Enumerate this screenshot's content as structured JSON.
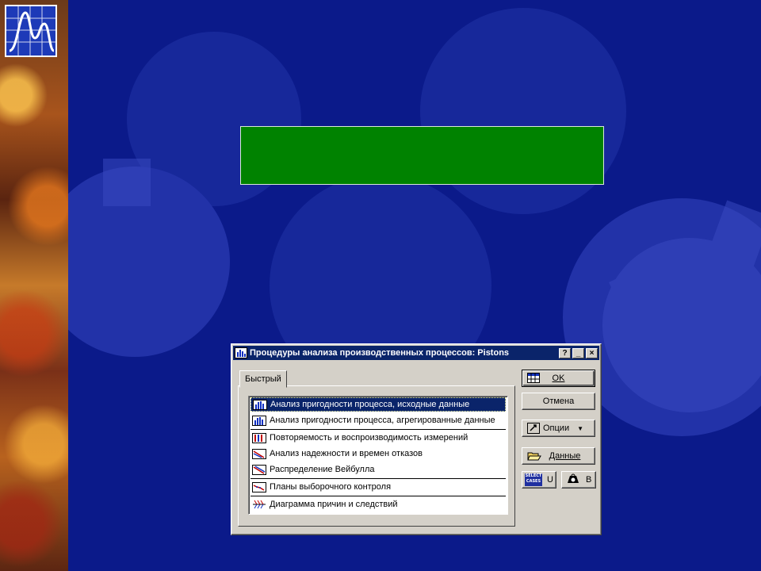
{
  "dialog": {
    "title": "Процедуры анализа производственных процессов: Pistons",
    "titlebar_buttons": {
      "help": "?",
      "minimize": "_",
      "close": "×"
    },
    "tab_label": "Быстрый",
    "list_items": [
      {
        "label": "Анализ пригодности процесса, исходные данные",
        "icon": "histogram-icon",
        "selected": true
      },
      {
        "label": "Анализ пригодности процесса, агрегированные данные",
        "icon": "histogram-icon",
        "selected": false
      },
      {
        "label": "Повторяемость и воспроизводимость измерений",
        "icon": "gauge-rr-icon",
        "selected": false
      },
      {
        "label": "Анализ надежности и времен отказов",
        "icon": "reliability-curve-icon",
        "selected": false
      },
      {
        "label": "Распределение Вейбулла",
        "icon": "weibull-icon",
        "selected": false
      },
      {
        "label": "Планы выборочного контроля",
        "icon": "sampling-plan-icon",
        "selected": false
      },
      {
        "label": "Диаграмма причин и следствий",
        "icon": "fishbone-icon",
        "selected": false
      }
    ],
    "buttons": {
      "ok": "OK",
      "cancel": "Отмена",
      "options": "Опции",
      "data": "Данные",
      "select_cases_icon_text": "SELECT CASES",
      "select_cases_label": "U",
      "weight_label": "B"
    }
  },
  "colors": {
    "slide_background": "#0b1a8a",
    "green_box": "#008200",
    "titlebar": "#0a246a",
    "dialog_face": "#d4d0c8"
  }
}
